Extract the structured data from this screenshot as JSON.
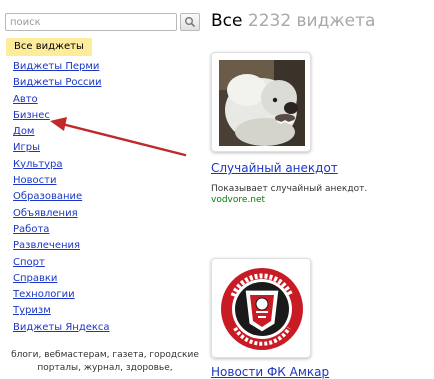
{
  "search": {
    "placeholder": "поиск"
  },
  "sidebar": {
    "all_widgets": "Все виджеты",
    "categories": [
      "Виджеты Перми",
      "Виджеты России",
      "Авто",
      "Бизнес",
      "Дом",
      "Игры",
      "Культура",
      "Новости",
      "Образование",
      "Объявления",
      "Работа",
      "Развлечения",
      "Спорт",
      "Справки",
      "Технологии",
      "Туризм",
      "Виджеты Яндекса"
    ],
    "tags": "блоги, вебмастерам, газета, городские порталы, журнал, здоровье,"
  },
  "header": {
    "title_prefix": "Все",
    "count_text": "2232 виджета"
  },
  "widgets": [
    {
      "title": "Случайный анекдот",
      "description": "Показывает случайный анекдот.",
      "source": "vodvore.net",
      "icon": "dog-photo"
    },
    {
      "title": "Новости ФК Амкар",
      "icon": "amkar-fc-logo",
      "logo_text": "ФУТБОЛЬНЫЙ КЛУБ ПЕРМЬ 1994"
    }
  ],
  "colors": {
    "link": "#1b36c4",
    "source": "#008000",
    "highlight": "#fcec9c",
    "arrow": "#c0282a"
  }
}
